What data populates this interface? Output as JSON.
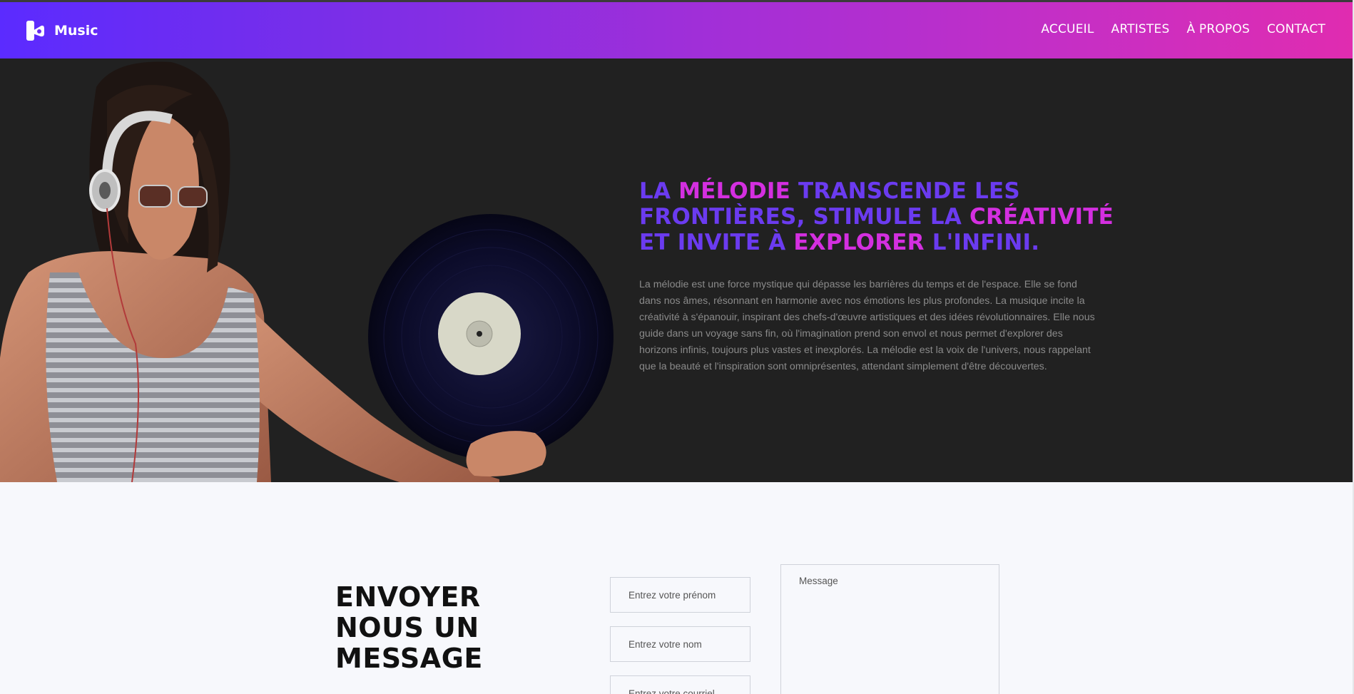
{
  "brand": {
    "name": "Music",
    "logo_icon": "music-logo-icon"
  },
  "nav": {
    "items": [
      {
        "label": "ACCUEIL"
      },
      {
        "label": "ARTISTES"
      },
      {
        "label": "À PROPOS"
      },
      {
        "label": "CONTACT"
      }
    ]
  },
  "hero": {
    "headline": {
      "p1": "LA ",
      "hl1": "MÉLODIE",
      "p2": " TRANSCENDE LES FRONTIÈRES, STIMULE LA ",
      "hl2": "CRÉATIVITÉ",
      "p3": " ET INVITE À ",
      "hl3": "EXPLORER",
      "p4": " L'INFINI."
    },
    "paragraph": "La mélodie est une force mystique qui dépasse les barrières du temps et de l'espace. Elle se fond dans nos âmes, résonnant en harmonie avec nos émotions les plus profondes. La musique incite la créativité à s'épanouir, inspirant des chefs-d'œuvre artistiques et des idées révolutionnaires. Elle nous guide dans un voyage sans fin, où l'imagination prend son envol et nous permet d'explorer des horizons infinis, toujours plus vastes et inexplorés. La mélodie est la voix de l'univers, nous rappelant que la beauté et l'inspiration sont omniprésentes, attendant simplement d'être découvertes.",
    "image_icons": [
      "dj-woman-illustration",
      "vinyl-record-icon"
    ]
  },
  "contact": {
    "title": "ENVOYER NOUS UN MESSAGE",
    "fields": {
      "firstname_placeholder": "Entrez votre prénom",
      "lastname_placeholder": "Entrez votre nom",
      "email_placeholder": "Entrez votre courriel",
      "message_placeholder": "Message"
    }
  },
  "colors": {
    "nav_gradient_start": "#5b2bff",
    "nav_gradient_end": "#e02cb0",
    "headline": "#6b3bf0",
    "headline_highlight": "#d42fe0",
    "hero_bg": "#212121",
    "page_bg": "#f7f8fc"
  }
}
